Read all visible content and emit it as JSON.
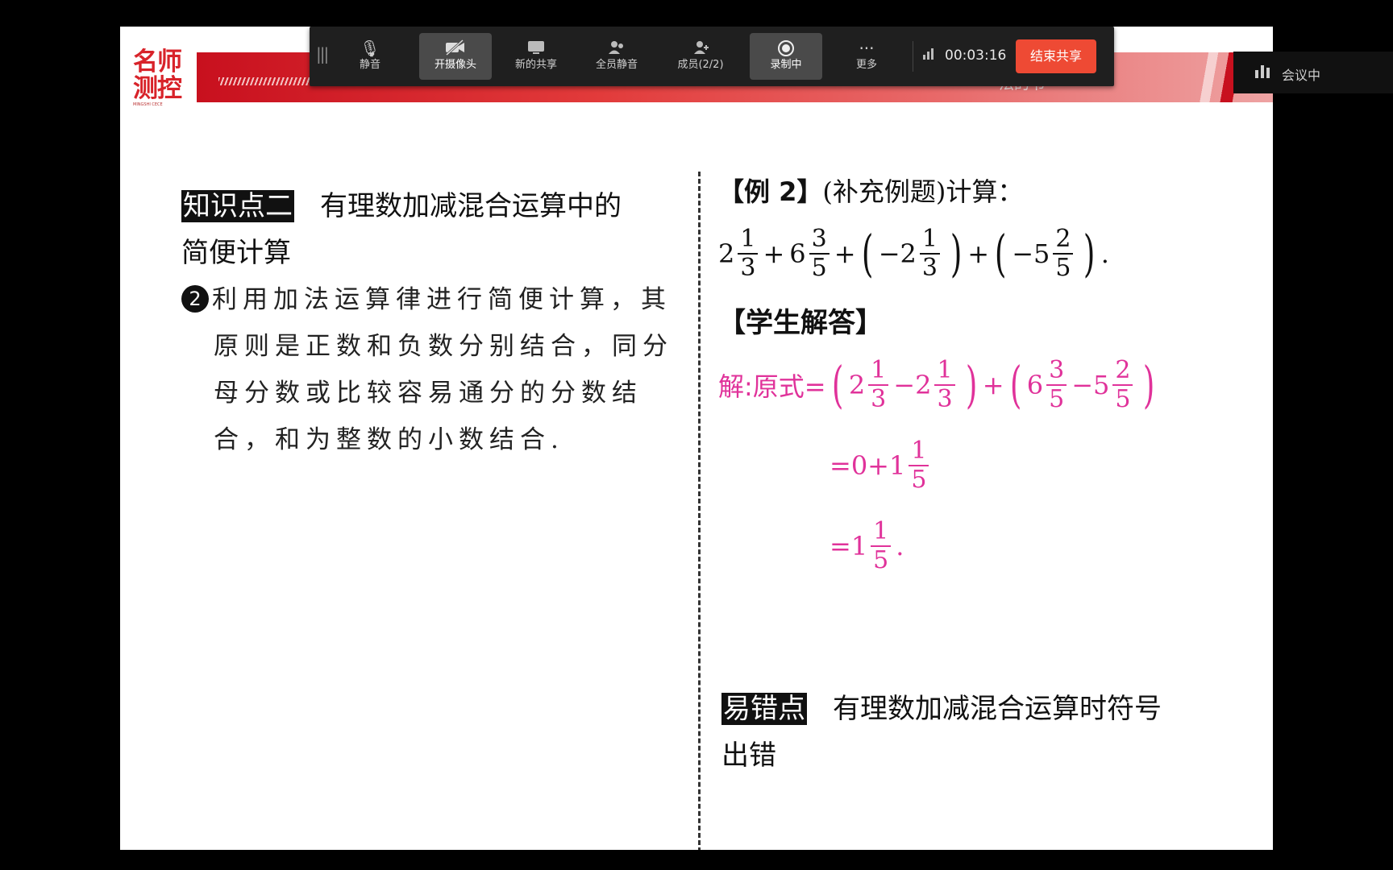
{
  "slide": {
    "logo_text": "名师测控",
    "logo_sub": "MINGSHI CECE",
    "banner_title": "法的书",
    "knowledge": {
      "tag": "知识点二",
      "title_line1": "有理数加减混合运算中的",
      "title_line2": "简便计算",
      "bullet_number": "2",
      "body_line1": "利用加法运算律进行简便计算，其",
      "body_line2": "原则是正数和负数分别结合，同分",
      "body_line3": "母分数或比较容易通分的分数结",
      "body_line4": "合，和为整数的小数结合."
    },
    "example": {
      "label": "【例 2】",
      "supplement": "(补充例题)计算：",
      "expression": {
        "a_whole": "2",
        "a_num": "1",
        "a_den": "3",
        "op1": "+",
        "b_whole": "6",
        "b_num": "3",
        "b_den": "5",
        "op2": "+",
        "c_whole": "−2",
        "c_num": "1",
        "c_den": "3",
        "op3": "+",
        "d_whole": "−5",
        "d_num": "2",
        "d_den": "5",
        "end": "."
      }
    },
    "student_answer_label": "【学生解答】",
    "solution": {
      "prefix": "解:原式=",
      "line1": {
        "g1_a_whole": "2",
        "g1_a_num": "1",
        "g1_a_den": "3",
        "g1_op": "−2",
        "g1_b_num": "1",
        "g1_b_den": "3",
        "mid_op": "+",
        "g2_a_whole": "6",
        "g2_a_num": "3",
        "g2_a_den": "5",
        "g2_op": "−5",
        "g2_b_num": "2",
        "g2_b_den": "5"
      },
      "line2_prefix": "=0+1",
      "line2_num": "1",
      "line2_den": "5",
      "line3_prefix": "=1",
      "line3_num": "1",
      "line3_den": "5",
      "line3_end": "."
    },
    "error_point": {
      "tag": "易错点",
      "title_line1": "有理数加减混合运算时符号",
      "title_line2": "出错"
    }
  },
  "toolbar": {
    "items": [
      {
        "label": "静音",
        "icon": "microphone-icon",
        "active": false
      },
      {
        "label": "开摄像头",
        "icon": "camera-off-icon",
        "active": true
      },
      {
        "label": "新的共享",
        "icon": "share-screen-icon",
        "active": false
      },
      {
        "label": "全员静音",
        "icon": "mute-all-icon",
        "active": false
      },
      {
        "label": "成员(2/2)",
        "icon": "members-icon",
        "active": false
      },
      {
        "label": "录制中",
        "icon": "record-icon",
        "active": true
      },
      {
        "label": "更多",
        "icon": "more-icon",
        "active": false
      }
    ],
    "timer": "00:03:16",
    "end_share_label": "结束共享",
    "end_share_color": "#ee4a34"
  },
  "meeting_status": {
    "label": "会议中",
    "icon": "signal-bars-icon"
  },
  "colors": {
    "solution": "#e0329a",
    "banner": "#c8101e"
  }
}
